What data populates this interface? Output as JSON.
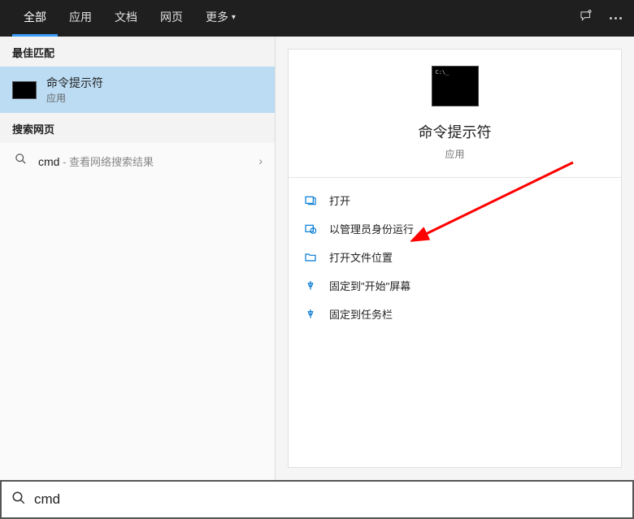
{
  "header": {
    "tabs": [
      "全部",
      "应用",
      "文档",
      "网页",
      "更多"
    ],
    "active_tab": "全部"
  },
  "left": {
    "section_best": "最佳匹配",
    "result": {
      "title": "命令提示符",
      "type": "应用"
    },
    "section_web": "搜索网页",
    "web": {
      "query": "cmd",
      "hint": " - 查看网络搜索结果"
    }
  },
  "preview": {
    "title": "命令提示符",
    "type": "应用",
    "actions": [
      {
        "label": "打开",
        "icon": "open"
      },
      {
        "label": "以管理员身份运行",
        "icon": "admin"
      },
      {
        "label": "打开文件位置",
        "icon": "folder"
      },
      {
        "label": "固定到\"开始\"屏幕",
        "icon": "pin-start"
      },
      {
        "label": "固定到任务栏",
        "icon": "pin-taskbar"
      }
    ]
  },
  "search": {
    "value": "cmd"
  }
}
